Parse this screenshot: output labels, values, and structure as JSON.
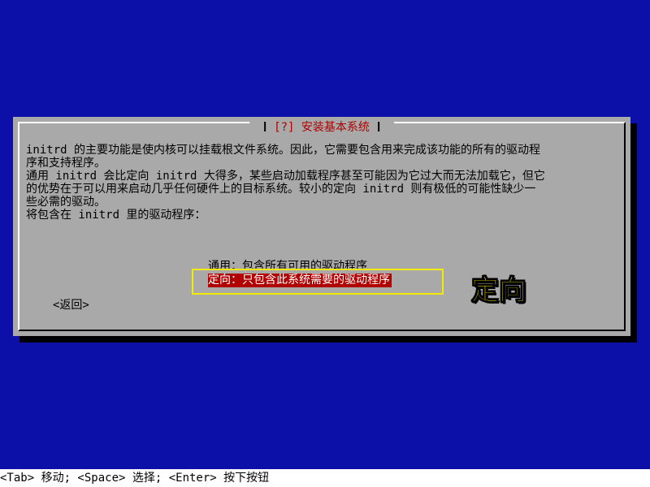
{
  "dialog": {
    "title": "[?] 安装基本系统",
    "paragraph1_line1": "initrd 的主要功能是使内核可以挂载根文件系统。因此，它需要包含用来完成该功能的所有的驱动程",
    "paragraph1_line2": "序和支持程序。",
    "paragraph2_line1": "通用 initrd 会比定向 initrd 大得多，某些启动加载程序甚至可能因为它过大而无法加载它，但它",
    "paragraph2_line2": "的优势在于可以用来启动几乎任何硬件上的目标系统。较小的定向 initrd 则有极低的可能性缺少一",
    "paragraph2_line3": "些必需的驱动。",
    "prompt": "将包含在 initrd 里的驱动程序：",
    "options": [
      {
        "label": "通用：包含所有可用的驱动程序",
        "selected": false
      },
      {
        "label": "定向：只包含此系统需要的驱动程序",
        "selected": true
      }
    ],
    "back_label": "<返回>"
  },
  "annotation": {
    "label": "定向",
    "color": "#ffe800"
  },
  "status_bar": {
    "text": "<Tab> 移动; <Space> 选择; <Enter> 按下按钮"
  },
  "colors": {
    "background": "#0c10a8",
    "dialog": "#a9a9a9",
    "title": "#b00000",
    "selected_bg": "#b00000",
    "highlight_box": "#f2ea00"
  }
}
